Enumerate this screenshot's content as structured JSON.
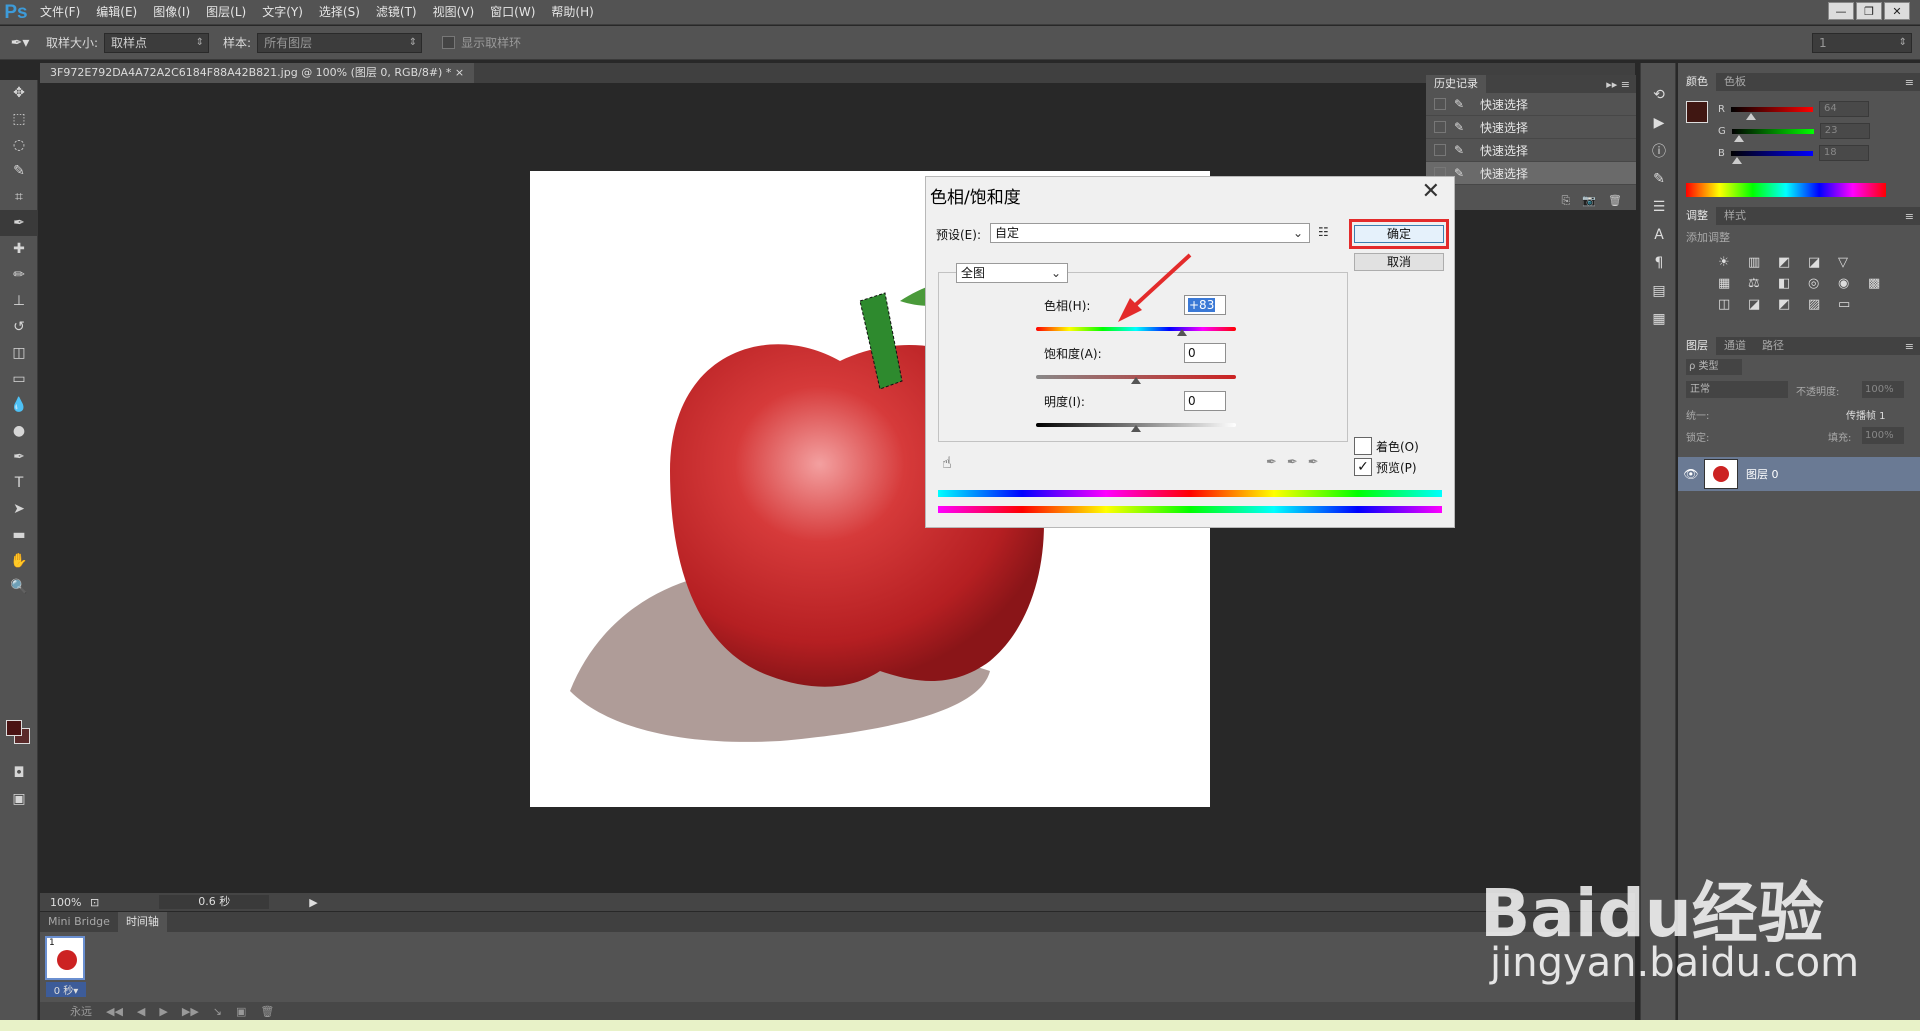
{
  "app": {
    "logo": "Ps",
    "menus": [
      "文件(F)",
      "编辑(E)",
      "图像(I)",
      "图层(L)",
      "文字(Y)",
      "选择(S)",
      "滤镜(T)",
      "视图(V)",
      "窗口(W)",
      "帮助(H)"
    ],
    "window_buttons": [
      "—",
      "❐",
      "✕"
    ]
  },
  "options": {
    "sample_size_label": "取样大小:",
    "sample_size_value": "取样点",
    "sample_label": "样本:",
    "sample_value": "所有图层",
    "show_ring_label": "显示取样环",
    "right_value": "1"
  },
  "document": {
    "tab_title": "3F972E792DA4A72A2C6184F88A42B821.jpg @ 100% (图层 0, RGB/8#) *",
    "zoom": "100%",
    "time": "0.6 秒"
  },
  "bottom": {
    "tabs": [
      "Mini Bridge",
      "时间轴"
    ],
    "frame_number": "1",
    "frame_delay": "0 秒▾",
    "loop": "永远"
  },
  "history": {
    "tabs": [
      "历史记录"
    ],
    "items": [
      "快速选择",
      "快速选择",
      "快速选择",
      "快速选择"
    ],
    "selected_index": 3
  },
  "color_panel": {
    "tabs": [
      "颜色",
      "色板"
    ],
    "channels": [
      {
        "label": "R",
        "value": "64",
        "level": 0.25
      },
      {
        "label": "G",
        "value": "23",
        "level": 0.09
      },
      {
        "label": "B",
        "value": "18",
        "level": 0.07
      }
    ],
    "foreground": "#401712"
  },
  "adjustments": {
    "tabs": [
      "调整",
      "样式"
    ],
    "add_label": "添加调整",
    "icons": [
      "☀",
      "▥",
      "◩",
      "◪",
      "▽",
      "",
      "▦",
      "⚖",
      "◧",
      "◎",
      "◉",
      "▩",
      "◫",
      "◪",
      "◩",
      "▨",
      "▭",
      ""
    ]
  },
  "layers_panel": {
    "tabs": [
      "图层",
      "通道",
      "路径"
    ],
    "kind_label": "ρ 类型",
    "blend_mode": "正常",
    "opacity_label": "不透明度:",
    "opacity_value": "100%",
    "unify_label": "统一:",
    "propagate_label": "传播帧 1",
    "lock_label": "锁定:",
    "fill_label": "填充:",
    "fill_value": "100%",
    "layer_name": "图层 0"
  },
  "dialog": {
    "title": "色相/饱和度",
    "preset_label": "预设(E):",
    "preset_value": "自定",
    "channel_value": "全图",
    "hue_label": "色相(H):",
    "hue_value": "+83",
    "hue_level": 0.73,
    "saturation_label": "饱和度(A):",
    "saturation_value": "0",
    "saturation_level": 0.5,
    "lightness_label": "明度(I):",
    "lightness_value": "0",
    "lightness_level": 0.5,
    "ok_label": "确定",
    "cancel_label": "取消",
    "colorize_label": "着色(O)",
    "preview_label": "预览(P)",
    "preview_checked": true,
    "colorize_checked": false
  },
  "watermark": {
    "brand": "Baidu经验",
    "url": "jingyan.baidu.com"
  },
  "colors": {
    "accent_red": "#e32b2b",
    "selection_blue": "#3b79d6",
    "ps_blue": "#3d9bd9"
  }
}
